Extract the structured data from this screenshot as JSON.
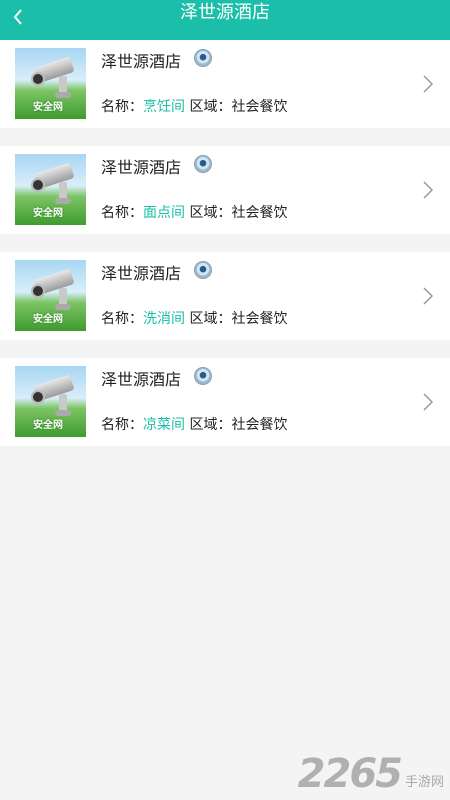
{
  "header": {
    "title": "泽世源酒店",
    "back_icon": "chevron-left-icon"
  },
  "labels": {
    "name_prefix": "名称：",
    "area_prefix": "区域：",
    "area_value": "社会餐饮"
  },
  "items": [
    {
      "title": "泽世源酒店",
      "room": "烹饪间",
      "area": "社会餐饮",
      "thumb_text": "安全网"
    },
    {
      "title": "泽世源酒店",
      "room": "面点间",
      "area": "社会餐饮",
      "thumb_text": "安全网"
    },
    {
      "title": "泽世源酒店",
      "room": "洗消间",
      "area": "社会餐饮",
      "thumb_text": "安全网"
    },
    {
      "title": "泽世源酒店",
      "room": "凉菜间",
      "area": "社会餐饮",
      "thumb_text": "安全网"
    }
  ],
  "colors": {
    "accent": "#1bbea8",
    "background": "#f4f4f4"
  },
  "watermark": {
    "number": "2265",
    "text": "手游网"
  }
}
